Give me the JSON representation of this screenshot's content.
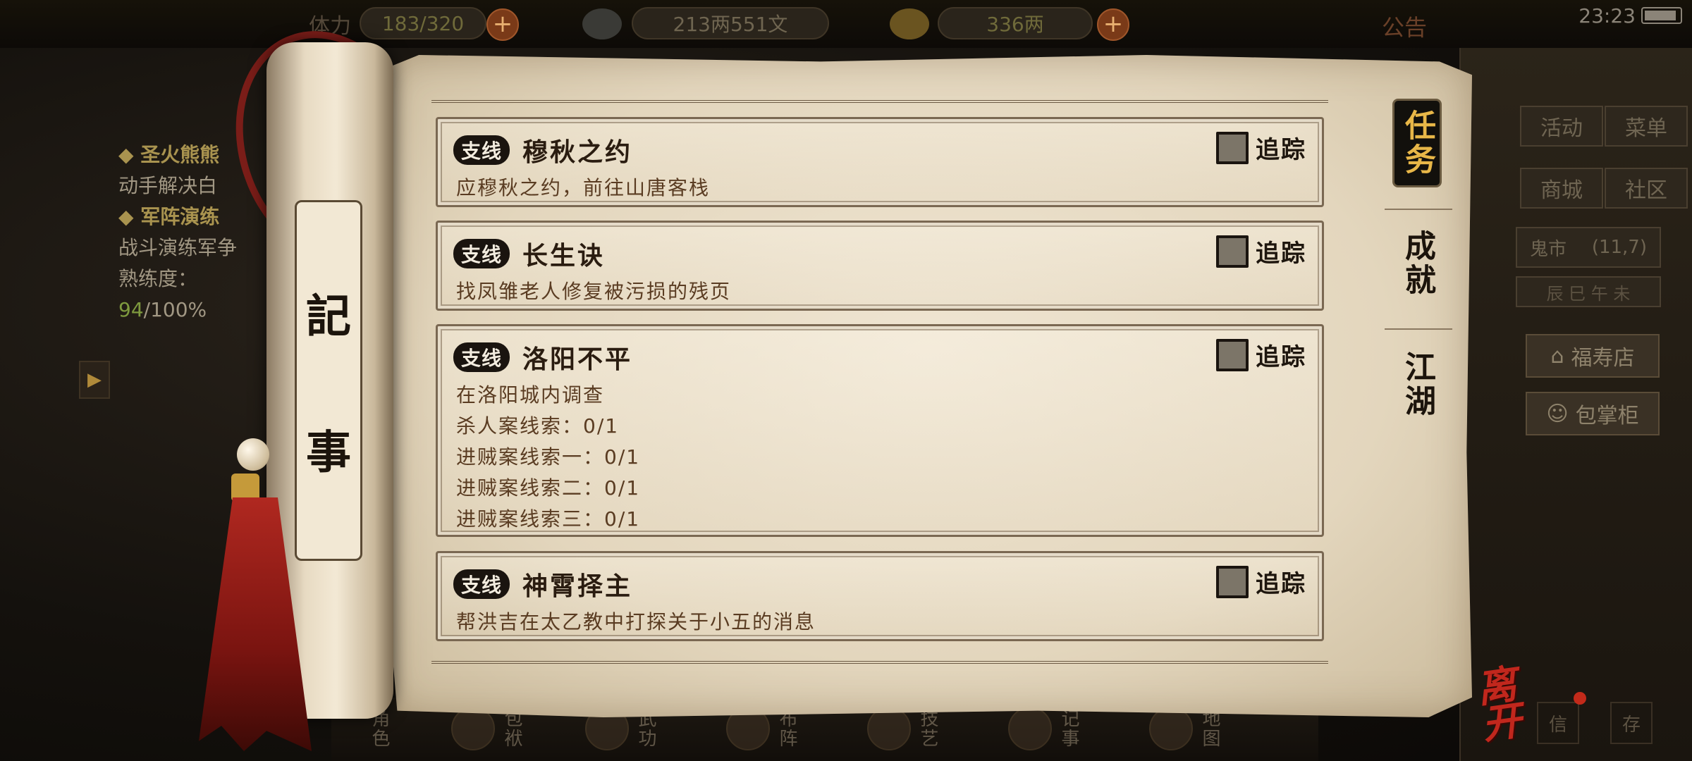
{
  "topbar": {
    "stamina_label": "体力",
    "stamina_value": "183/320",
    "money_value": "213两551文",
    "gold_value": "336两",
    "notice_label": "公告",
    "time": "23:23"
  },
  "left_hints": {
    "quest1_title": "◆ 圣火熊熊",
    "quest1_desc": "动手解决白",
    "quest2_title": "◆ 军阵演练",
    "quest2_desc": "战斗演练军争",
    "proficiency_label": "熟练度：",
    "proficiency_value": "94",
    "proficiency_total": "/100%"
  },
  "right_panel": {
    "activity": "活动",
    "menu": "菜单",
    "mall": "商城",
    "community": "社区",
    "location_name": "鬼市",
    "location_coords": "(11,7)",
    "time_dial": "辰 巳 午 未",
    "shop1": "福寿店",
    "shop2": "包掌柜",
    "mail": "信",
    "store": "存"
  },
  "bottom_bar": [
    {
      "label": "角色"
    },
    {
      "label": "包袱"
    },
    {
      "label": "武功"
    },
    {
      "label": "布阵"
    },
    {
      "label": "技艺"
    },
    {
      "label": "记事"
    },
    {
      "label": "地图"
    }
  ],
  "scroll": {
    "title_line1": "記",
    "title_line2": "事"
  },
  "quests": [
    {
      "badge": "支线",
      "title": "穆秋之约",
      "track": "追踪",
      "lines": [
        "应穆秋之约，前往山唐客栈"
      ]
    },
    {
      "badge": "支线",
      "title": "长生诀",
      "track": "追踪",
      "lines": [
        "找凤雏老人修复被污损的残页"
      ]
    },
    {
      "badge": "支线",
      "title": "洛阳不平",
      "track": "追踪",
      "lines": [
        "在洛阳城内调查",
        "杀人案线索：0/1",
        "进贼案线索一：0/1",
        "进贼案线索二：0/1",
        "进贼案线索三：0/1"
      ]
    },
    {
      "badge": "支线",
      "title": "神霄择主",
      "track": "追踪",
      "lines": [
        "帮洪吉在太乙教中打探关于小五的消息"
      ]
    }
  ],
  "tabs": {
    "quests": "任务",
    "achievements": "成就",
    "jianghu": "江湖"
  },
  "leave_label": "离开",
  "colors": {
    "parchment": "#e8dcc5",
    "badge_bg": "#1a140f",
    "active_tab_text": "#e8b748",
    "leave_red": "#c1271d"
  }
}
